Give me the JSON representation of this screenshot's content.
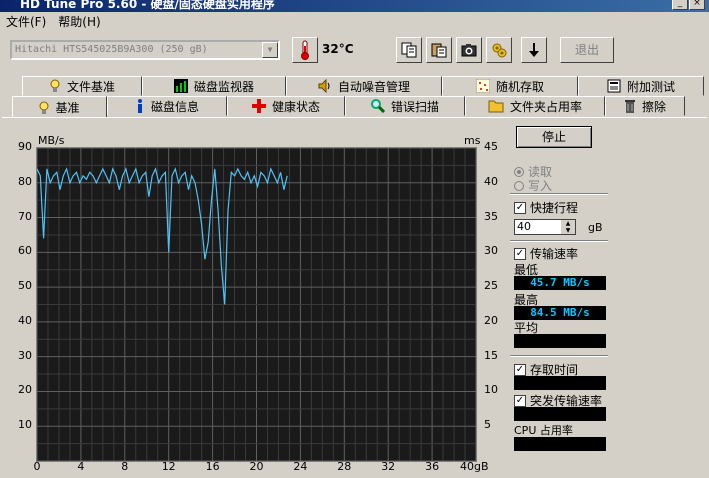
{
  "titlebar": {
    "title": "HD Tune Pro 5.60 - 硬盘/固态硬盘实用程序",
    "close": "×"
  },
  "menu": [
    "文件(F)",
    "帮助(H)"
  ],
  "toolbar": {
    "drive": "Hitachi HTS545025B9A300 (250 gB)",
    "temperature": "32°C",
    "exit_label": "退出",
    "buttons": [
      "copy-icon",
      "paste-icon",
      "camera-icon",
      "tools-icon",
      "save-icon"
    ]
  },
  "tabs_top": [
    "文件基准",
    "磁盘监视器",
    "自动噪音管理",
    "随机存取",
    "附加测试"
  ],
  "tabs_bottom": [
    "基准",
    "磁盘信息",
    "健康状态",
    "错误扫描",
    "文件夹占用率",
    "擦除"
  ],
  "side": {
    "stop_label": "停止",
    "read_label": "读取",
    "write_label": "写入",
    "quick_label": "快捷行程",
    "quick_value": "40",
    "quick_unit": "gB",
    "transfer_label": "传输速率",
    "min_label": "最低",
    "min_value": "45.7 MB/s",
    "max_label": "最高",
    "max_value": "84.5 MB/s",
    "avg_label": "平均",
    "avg_value": "",
    "access_label": "存取时间",
    "access_value": "",
    "burst_label": "突发传输速率",
    "burst_value": "",
    "cpu_label": "CPU 占用率",
    "cpu_value": ""
  },
  "chart_data": {
    "type": "line",
    "ylabel_left": "MB/s",
    "ylabel_right": "ms",
    "xunit": "gB",
    "ylim": [
      0,
      90
    ],
    "ylim_right": [
      0,
      45
    ],
    "xlim": [
      0,
      40
    ],
    "y_ticks": [
      "90",
      "80",
      "70",
      "60",
      "50",
      "40",
      "30",
      "20",
      "10"
    ],
    "y_ticks_right": [
      "45",
      "40",
      "35",
      "30",
      "25",
      "20",
      "15",
      "10",
      "5"
    ],
    "x_ticks": [
      "0",
      "4",
      "8",
      "12",
      "16",
      "20",
      "24",
      "28",
      "32",
      "36",
      "40gB"
    ],
    "color": "#4fc3f7",
    "grid": true,
    "series": [
      {
        "x": [
          0,
          0.3,
          0.6,
          0.9,
          1.2,
          1.5,
          1.8,
          2.1,
          2.4,
          2.7,
          3.0,
          3.3,
          3.6,
          3.9,
          4.2,
          4.5,
          4.8,
          5.1,
          5.4,
          5.7,
          6.0,
          6.3,
          6.6,
          6.9,
          7.2,
          7.5,
          7.8,
          8.1,
          8.4,
          8.7,
          9.0,
          9.3,
          9.6,
          9.9,
          10.2,
          10.5,
          10.8,
          11.1,
          11.4,
          11.7,
          12.0,
          12.3,
          12.6,
          12.9,
          13.2,
          13.5,
          13.8,
          14.1,
          14.4,
          14.7,
          15.0,
          15.3,
          15.6,
          15.9,
          16.2,
          16.5,
          16.8,
          17.1,
          17.4,
          17.7,
          18.0,
          18.3,
          18.6,
          18.9,
          19.2,
          19.5,
          19.8,
          20.1,
          20.4,
          20.7,
          21.0,
          21.3,
          21.6,
          21.9,
          22.2,
          22.5,
          22.8
        ],
        "values": [
          84,
          82,
          64,
          84,
          80,
          82,
          83,
          78,
          82,
          84,
          80,
          82,
          83,
          80,
          82,
          81,
          83,
          82,
          80,
          82,
          84,
          82,
          80,
          84,
          82,
          78,
          82,
          84,
          80,
          82,
          84,
          80,
          82,
          83,
          76,
          82,
          84,
          80,
          82,
          83,
          60,
          82,
          84,
          80,
          82,
          83,
          78,
          82,
          80,
          75,
          68,
          58,
          63,
          75,
          84,
          72,
          56,
          45,
          72,
          83,
          82,
          84,
          82,
          81,
          83,
          80,
          82,
          79,
          83,
          82,
          80,
          84,
          82,
          80,
          83,
          78,
          82
        ]
      }
    ]
  }
}
